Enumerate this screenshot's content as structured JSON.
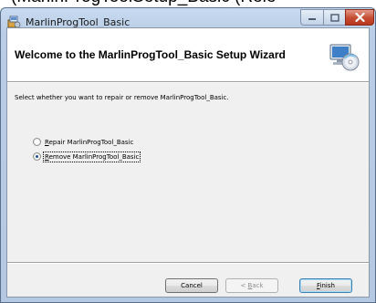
{
  "behind_window_caption": "(MarlinProgToolSetup_Basic (Rele",
  "window": {
    "title": "MarlinProgTool_Basic",
    "app_icon": "installer-icon",
    "controls": [
      "minimize-icon",
      "maximize-icon",
      "close-icon"
    ]
  },
  "banner": {
    "heading": "Welcome to the MarlinProgTool_Basic Setup Wizard",
    "icon": "computer-disc-icon"
  },
  "instruction": "Select whether you want to repair or remove MarlinProgTool_Basic.",
  "options": [
    {
      "accel": "R",
      "rest": "epair MarlinProgTool_Basic",
      "selected": false
    },
    {
      "accel": "R",
      "rest": "emove MarlinProgTool_Basic",
      "selected": true
    }
  ],
  "buttons": {
    "cancel": "Cancel",
    "back_prefix": "< ",
    "back_accel": "B",
    "back_rest": "ack",
    "finish_accel": "F",
    "finish_rest": "inish"
  },
  "colors": {
    "title_bar": "#b9cde6",
    "close_button": "#c44a31",
    "dialog_face": "#f0f0f0",
    "banner": "#ffffff"
  }
}
